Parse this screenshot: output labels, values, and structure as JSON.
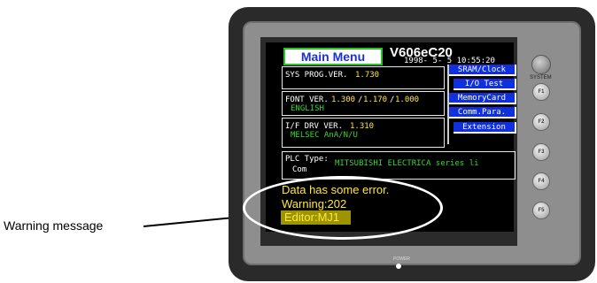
{
  "callout": {
    "label": "Warning message"
  },
  "device": {
    "system_label": "SYSTEM",
    "power_label": "POWER",
    "function_keys": [
      "F1",
      "F2",
      "F3",
      "F4",
      "F5"
    ]
  },
  "screen": {
    "title": "Main Menu",
    "model": "V606eC20",
    "datetime": "1998- 5- 5 10:55:20",
    "sys_prog": {
      "label": "SYS PROG.VER.",
      "value": "1.730"
    },
    "font_ver": {
      "label": "FONT VER.",
      "v1": "1.300",
      "v2": "1.170",
      "v3": "1.000",
      "sub": "ENGLISH"
    },
    "if_drv": {
      "label": "I/F DRV VER.",
      "value": "1.310",
      "sub": "MELSEC AnA/N/U"
    },
    "plc": {
      "label": "PLC Type:",
      "value": "MITSUBISHI ELECTRICA series li",
      "extra": "Com"
    },
    "menu": [
      "SRAM/Clock",
      "I/O Test",
      "MemoryCard",
      "Comm.Para.",
      "Extension"
    ],
    "error": {
      "line1": "Data has some error.",
      "line2": "Warning:202",
      "line3": "Editor:MJ1"
    }
  }
}
